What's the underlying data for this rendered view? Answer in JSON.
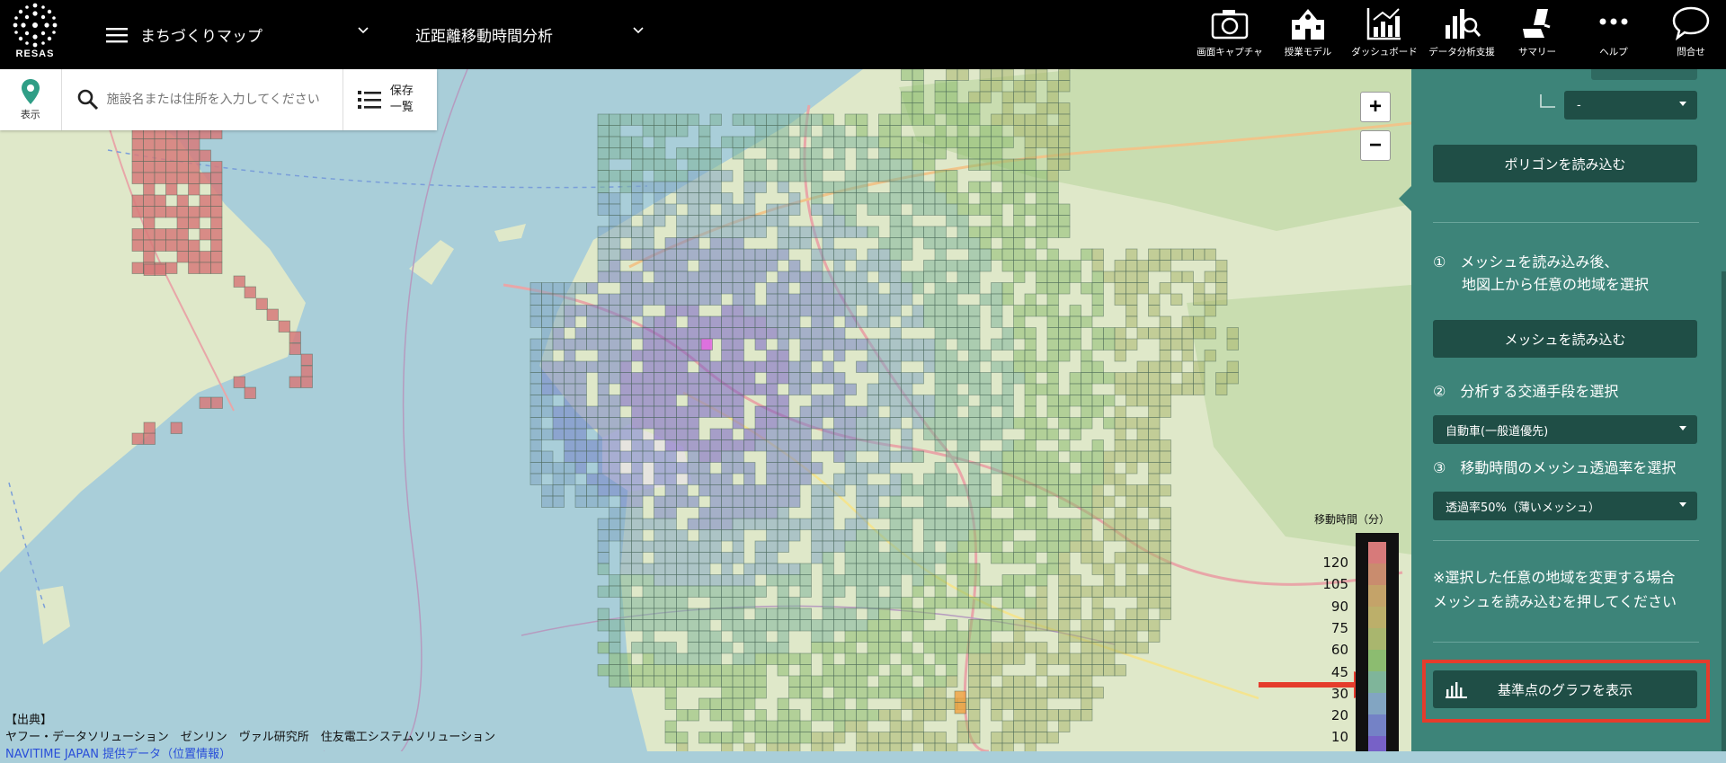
{
  "app": {
    "logo_text": "RESAS",
    "menu_title": "まちづくりマップ",
    "analysis_title": "近距離移動時間分析"
  },
  "toolbar": [
    {
      "label": "画面キャプチャ",
      "icon": "camera-icon"
    },
    {
      "label": "授業モデル",
      "icon": "school-icon"
    },
    {
      "label": "ダッシュボード",
      "icon": "dashboard-icon"
    },
    {
      "label": "データ分析支援",
      "icon": "data-analysis-icon"
    },
    {
      "label": "サマリー",
      "icon": "summary-icon"
    },
    {
      "label": "ヘルプ",
      "icon": "more-icon"
    },
    {
      "label": "問合せ",
      "icon": "chat-icon"
    }
  ],
  "search": {
    "show_label": "表示",
    "placeholder": "施設名または住所を入力してください",
    "saved_label": "保存一覧"
  },
  "zoom": {
    "in": "+",
    "out": "−"
  },
  "legend": {
    "title": "移動時間（分）",
    "labels": [
      "120",
      "105",
      "90",
      "75",
      "60",
      "45",
      "30",
      "20",
      "10"
    ],
    "colors": [
      "#d77a7a",
      "#c98c6e",
      "#c4a369",
      "#bcaf6a",
      "#a9b66e",
      "#8cbc70",
      "#7fb59a",
      "#82a5c2",
      "#7482c6",
      "#7761c7"
    ]
  },
  "attribution": {
    "heading": "【出典】",
    "line1": "ヤフー・データソリューション　ゼンリン　ヴァル研究所　住友電工システムソリューション",
    "line2": "NAVITIME JAPAN 提供データ（位置情報）"
  },
  "panel": {
    "sub_select_value": "-",
    "polygon_button": "ポリゴンを読み込む",
    "step1_text": "①　メッシュを読み込み後、\n　　地図上から任意の地域を選択",
    "mesh_button": "メッシュを読み込む",
    "step2_text": "②　分析する交通手段を選択",
    "transport_value": "自動車(一般道優先)",
    "step3_text": "③　移動時間のメッシュ透過率を選択",
    "opacity_value": "透過率50%（薄いメッシュ）",
    "note_text": "※選択した任意の地域を変更する場合\nメッシュを読み込むを押してください",
    "graph_button": "基準点のグラフを表示"
  },
  "colors": {
    "panel_bg": "#3d8479",
    "panel_button": "#1f4e46",
    "highlight": "#e53c2c",
    "sea": "#a9ced9",
    "land": "#dfe8c9"
  }
}
